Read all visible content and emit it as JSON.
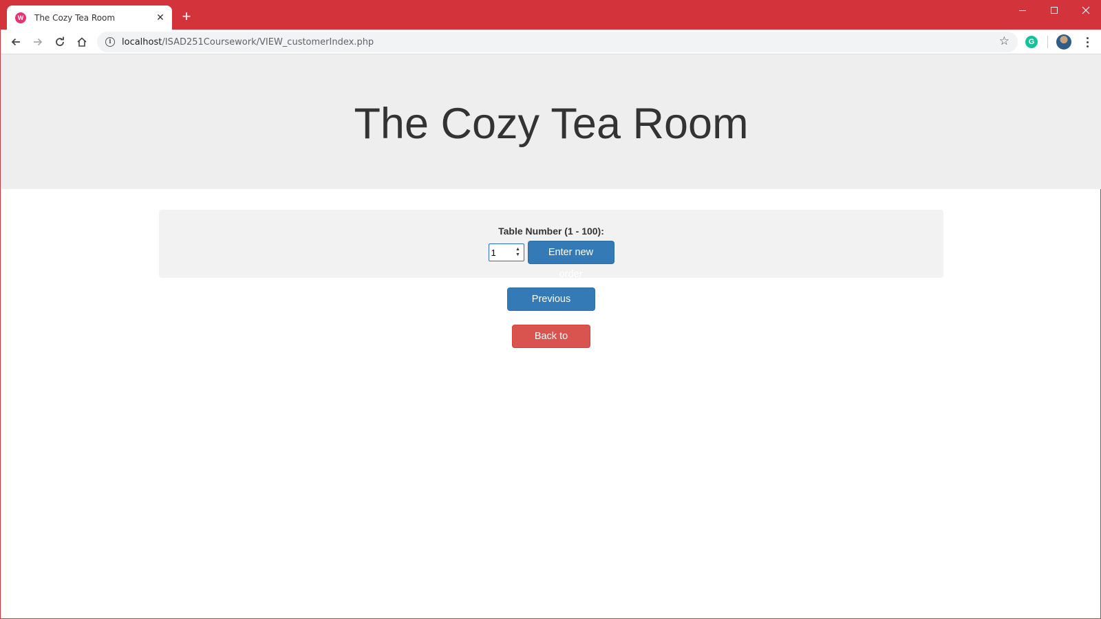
{
  "browser": {
    "tab_title": "The Cozy Tea Room",
    "tab_favicon_glyph": "W",
    "new_tab_glyph": "+",
    "close_glyph": "✕",
    "url_host": "localhost",
    "url_path": "/ISAD251Coursework/VIEW_customerIndex.php",
    "extension_glyph": "G",
    "accent_color": "#d3343c"
  },
  "header": {
    "title": "The Cozy Tea Room"
  },
  "order_form": {
    "table_label": "Table Number (1 - 100):",
    "table_value": "1",
    "enter_button": "Enter new order"
  },
  "actions": {
    "previous_orders": "Previous Orders",
    "back_home": "Back to Home"
  },
  "colors": {
    "primary": "#337ab7",
    "danger": "#d9534f",
    "jumbotron_bg": "#eeeeee",
    "well_bg": "#f2f2f2"
  }
}
